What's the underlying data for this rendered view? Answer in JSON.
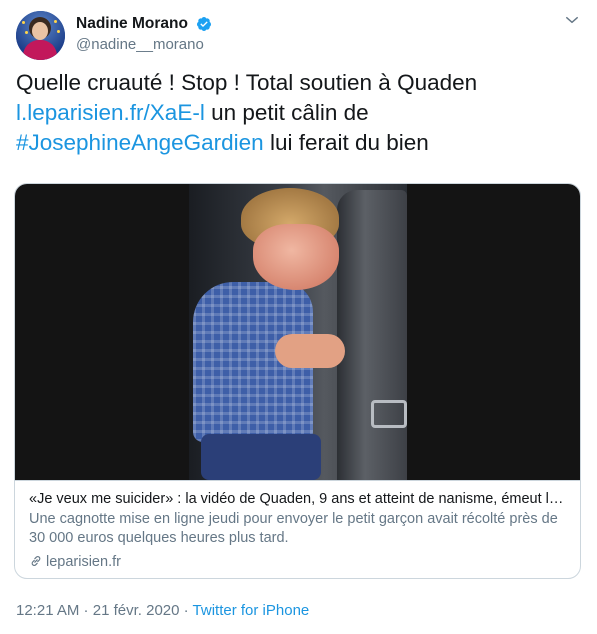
{
  "author": {
    "display_name": "Nadine Morano",
    "handle": "@nadine__morano",
    "verified": true
  },
  "tweet": {
    "line1": "Quelle cruauté ! Stop ! Total soutien à Quaden",
    "link_text": "l.leparisien.fr/XaE-l",
    "after_link": " un petit câlin de",
    "hashtag": "#JosephineAngeGardien",
    "line3_rest": " lui ferait du bien"
  },
  "card": {
    "title": "«Je veux me suicider» : la vidéo de Quaden, 9 ans et atteint de nanisme, émeut le…",
    "description": "Une cagnotte mise en ligne jeudi pour envoyer le petit garçon avait récolté près de 30 000 euros quelques heures plus tard.",
    "domain": "leparisien.fr"
  },
  "meta": {
    "time": "12:21 AM",
    "separator": " · ",
    "date": "21 févr. 2020",
    "source": "Twitter for iPhone"
  },
  "colors": {
    "link": "#1b95e0",
    "secondary_text": "#657786",
    "border": "#ccd6dd",
    "verified": "#1da1f2"
  },
  "icons": {
    "verified": "verified-badge-icon",
    "caret": "chevron-down-icon",
    "link": "link-icon"
  }
}
